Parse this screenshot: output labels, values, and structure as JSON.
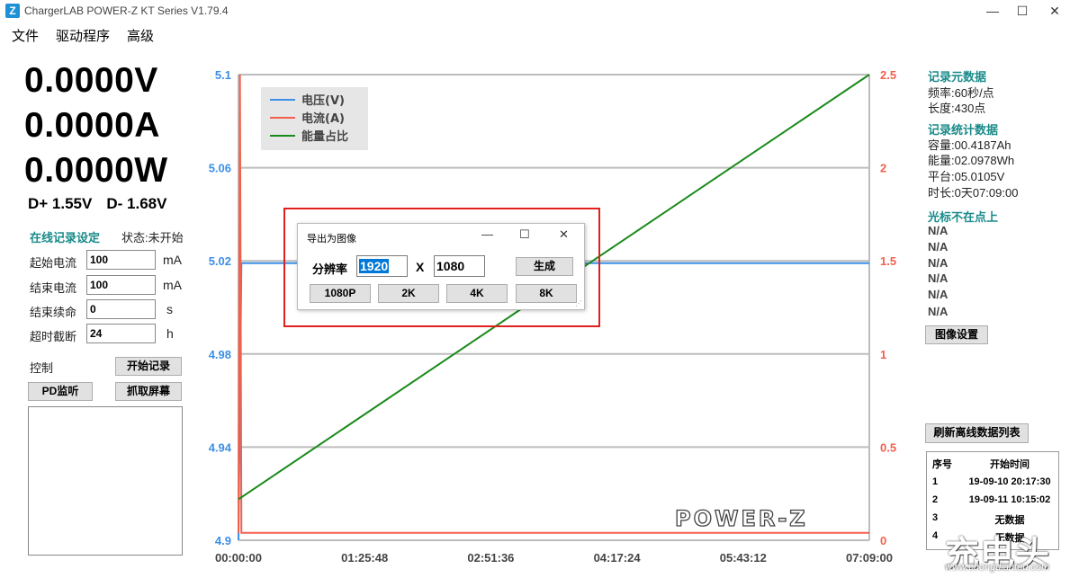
{
  "window": {
    "title": "ChargerLAB POWER-Z KT Series V1.79.4",
    "icon_letter": "Z",
    "minimize": "—",
    "maximize": "☐",
    "close": "✕"
  },
  "menu": [
    "文件",
    "驱动程序",
    "高级"
  ],
  "readings": {
    "voltage": "0.0000V",
    "current": "0.0000A",
    "power": "0.0000W",
    "dplus": "D+ 1.55V",
    "dminus": "D- 1.68V"
  },
  "online_record": {
    "heading": "在线记录设定",
    "status": "状态:未开始",
    "fields": [
      {
        "label": "起始电流",
        "value": "100",
        "unit": "mA"
      },
      {
        "label": "结束电流",
        "value": "100",
        "unit": "mA"
      },
      {
        "label": "结束续命",
        "value": "0",
        "unit": "s"
      },
      {
        "label": "超时截断",
        "value": "24",
        "unit": "h"
      }
    ],
    "control_label": "控制",
    "start_button": "开始记录",
    "pd_button": "PD监听",
    "capture_button": "抓取屏幕"
  },
  "chart_data": {
    "type": "line",
    "legend": [
      "电压(V)",
      "电流(A)",
      "能量占比"
    ],
    "colors": {
      "voltage": "#3c8fe6",
      "current": "#f2604d",
      "energy": "#1a8a1a",
      "grid": "#bdbdbd"
    },
    "x_ticks": [
      "00:00:00",
      "01:25:48",
      "02:51:36",
      "04:17:24",
      "05:43:12",
      "07:09:00"
    ],
    "y_left_ticks": [
      "5.1",
      "5.06",
      "5.02",
      "4.98",
      "4.94",
      "4.9"
    ],
    "y_right_ticks": [
      "2.5",
      "2",
      "1.5",
      "1",
      "0.5",
      "0"
    ],
    "y_left_range": [
      4.9,
      5.1
    ],
    "y_right_range": [
      0,
      2.5
    ],
    "x_range_seconds": [
      0,
      25740
    ],
    "series": [
      {
        "name": "电压(V)",
        "axis": "left",
        "points": [
          [
            0,
            4.9
          ],
          [
            120,
            5.019
          ],
          [
            25740,
            5.019
          ]
        ]
      },
      {
        "name": "电流(A)",
        "axis": "right",
        "points": [
          [
            0,
            0.04
          ],
          [
            60,
            2.5
          ],
          [
            120,
            0.04
          ],
          [
            25740,
            0.04
          ]
        ]
      },
      {
        "name": "能量占比",
        "axis": "right",
        "points": [
          [
            0,
            0.22
          ],
          [
            25740,
            2.5
          ]
        ]
      }
    ],
    "logo": "POWER-Z"
  },
  "right_panel": {
    "meta_heading": "记录元数据",
    "rate": "频率:60秒/点",
    "length": "长度:430点",
    "stats_heading": "记录统计数据",
    "capacity": "容量:00.4187Ah",
    "energy": "能量:02.0978Wh",
    "platform": "平台:05.0105V",
    "duration": "时长:0天07:09:00",
    "cursor_heading": "光标不在点上",
    "na_values": [
      "N/A",
      "N/A",
      "N/A",
      "N/A",
      "N/A",
      "N/A"
    ],
    "image_settings_button": "图像设置",
    "refresh_button": "刷新离线数据列表",
    "table": {
      "headers": [
        "序号",
        "开始时间"
      ],
      "rows": [
        [
          "1",
          "19-09-10 20:17:30"
        ],
        [
          "2",
          "19-09-11 10:15:02"
        ],
        [
          "3",
          "无数据"
        ],
        [
          "4",
          "无数据"
        ]
      ]
    }
  },
  "export_dialog": {
    "title": "导出为图像",
    "resolution_label": "分辨率",
    "width": "1920",
    "height": "1080",
    "x": "X",
    "generate_button": "生成",
    "presets": [
      "1080P",
      "2K",
      "4K",
      "8K"
    ]
  },
  "watermark": {
    "text": "充电头",
    "url": "www.chongdiantou.com"
  }
}
